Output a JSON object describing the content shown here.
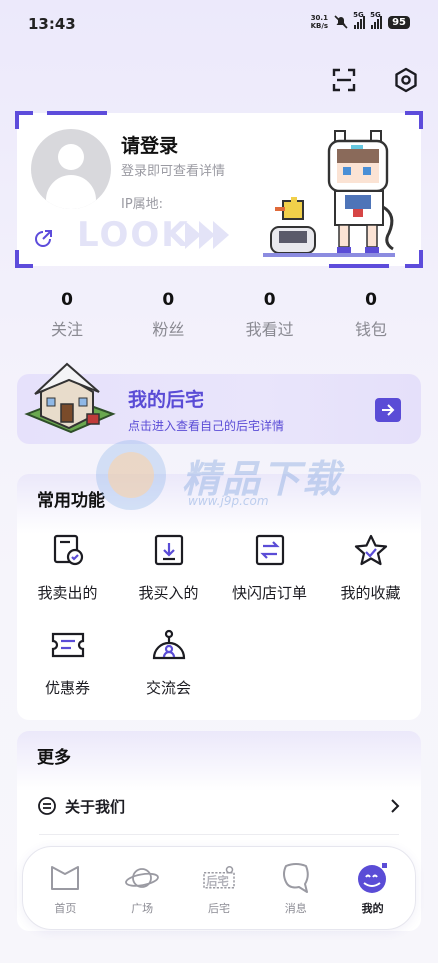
{
  "status_bar": {
    "time": "13:43",
    "net_speed_value": "30.1",
    "net_speed_unit": "KB/s",
    "signal_1": "5G",
    "signal_2": "5G",
    "battery": "95"
  },
  "header": {
    "scan_icon": "scan-icon",
    "settings_icon": "gear-icon"
  },
  "profile": {
    "title": "请登录",
    "hint": "登录即可查看详情",
    "ip_label": "IP属地:",
    "logo": "LOOK",
    "accent": "#5d4cdb"
  },
  "stats": [
    {
      "value": "0",
      "label": "关注"
    },
    {
      "value": "0",
      "label": "粉丝"
    },
    {
      "value": "0",
      "label": "我看过"
    },
    {
      "value": "0",
      "label": "钱包"
    }
  ],
  "house": {
    "title": "我的后宅",
    "subtitle": "点击进入查看自己的后宅详情",
    "color": "#5a4cd6"
  },
  "watermark": {
    "text": "精品下载",
    "url": "www.j9p.com"
  },
  "functions": {
    "title": "常用功能",
    "items": [
      {
        "label": "我卖出的",
        "icon": "sold-icon"
      },
      {
        "label": "我买入的",
        "icon": "bought-icon"
      },
      {
        "label": "快闪店订单",
        "icon": "flash-order-icon"
      },
      {
        "label": "我的收藏",
        "icon": "star-icon"
      },
      {
        "label": "优惠券",
        "icon": "coupon-icon"
      },
      {
        "label": "交流会",
        "icon": "meetup-icon"
      }
    ]
  },
  "more": {
    "title": "更多",
    "items": [
      {
        "label": "关于我们",
        "icon": "info-icon"
      }
    ]
  },
  "tabs": [
    {
      "label": "首页",
      "icon": "home-icon",
      "active": false
    },
    {
      "label": "广场",
      "icon": "planet-icon",
      "active": false
    },
    {
      "label": "后宅",
      "icon": "house-logo-icon",
      "active": false
    },
    {
      "label": "消息",
      "icon": "message-icon",
      "active": false
    },
    {
      "label": "我的",
      "icon": "profile-icon",
      "active": true
    }
  ]
}
